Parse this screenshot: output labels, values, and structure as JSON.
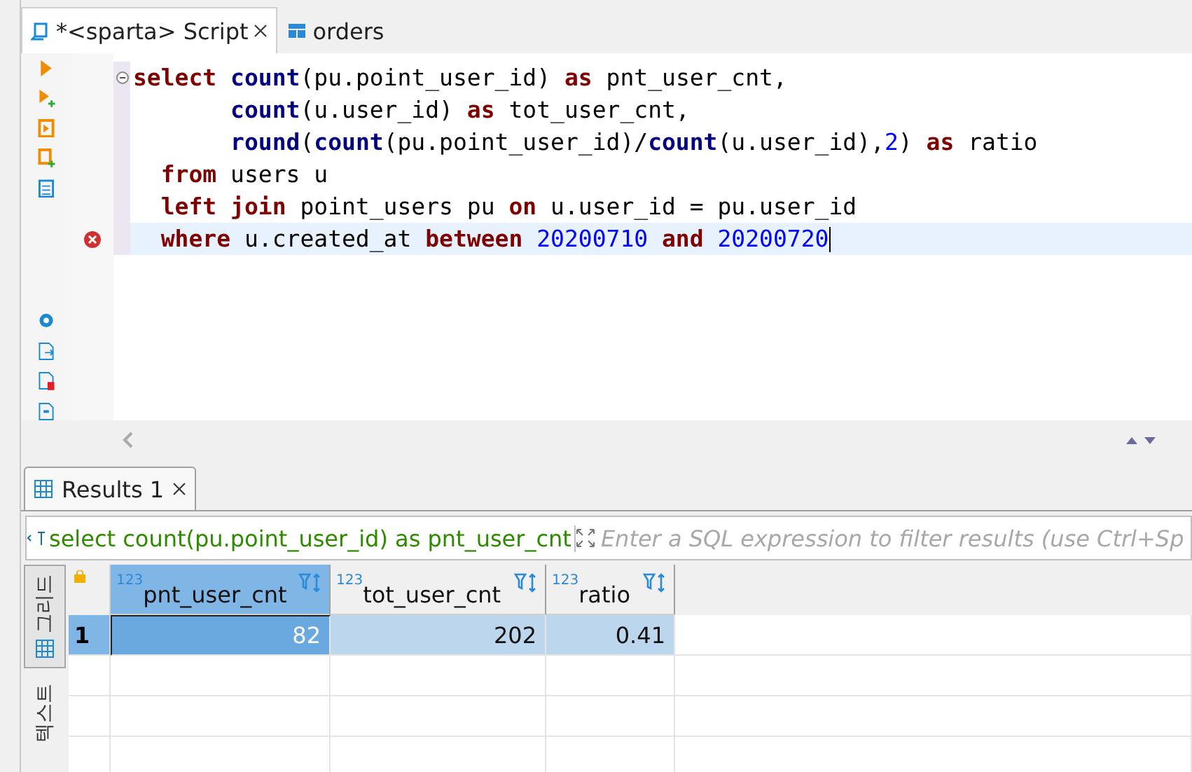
{
  "editor_tabs": [
    {
      "label": "*<sparta> Script",
      "kind": "script",
      "selected": true
    },
    {
      "label": "orders",
      "kind": "table",
      "selected": false
    }
  ],
  "sql_lines": [
    {
      "kind": "head",
      "error": false,
      "current": false,
      "fold": true,
      "tokens": [
        {
          "kind": "keyword",
          "text": "select "
        },
        {
          "kind": "function",
          "text": "count"
        },
        {
          "kind": "plain",
          "text": "(pu.point_user_id) "
        },
        {
          "kind": "keyword",
          "text": "as"
        },
        {
          "kind": "plain",
          "text": " pnt_user_cnt,"
        }
      ]
    },
    {
      "kind": "item",
      "error": false,
      "current": false,
      "fold": false,
      "tokens": [
        {
          "kind": "function",
          "text": "count"
        },
        {
          "kind": "plain",
          "text": "(u.user_id) "
        },
        {
          "kind": "keyword",
          "text": "as"
        },
        {
          "kind": "plain",
          "text": " tot_user_cnt,"
        }
      ]
    },
    {
      "kind": "item",
      "error": false,
      "current": false,
      "fold": false,
      "tokens": [
        {
          "kind": "function",
          "text": "round"
        },
        {
          "kind": "plain",
          "text": "("
        },
        {
          "kind": "function",
          "text": "count"
        },
        {
          "kind": "plain",
          "text": "(pu.point_user_id)/"
        },
        {
          "kind": "function",
          "text": "count"
        },
        {
          "kind": "plain",
          "text": "(u.user_id),"
        },
        {
          "kind": "number",
          "text": "2"
        },
        {
          "kind": "plain",
          "text": ") "
        },
        {
          "kind": "keyword",
          "text": "as"
        },
        {
          "kind": "plain",
          "text": " ratio"
        }
      ]
    },
    {
      "kind": "clause",
      "error": false,
      "current": false,
      "fold": false,
      "tokens": [
        {
          "kind": "keyword",
          "text": "from"
        },
        {
          "kind": "plain",
          "text": " users u"
        }
      ]
    },
    {
      "kind": "clause",
      "error": false,
      "current": false,
      "fold": false,
      "tokens": [
        {
          "kind": "keyword",
          "text": "left join"
        },
        {
          "kind": "plain",
          "text": " point_users pu "
        },
        {
          "kind": "keyword",
          "text": "on"
        },
        {
          "kind": "plain",
          "text": " u.user_id = pu.user_id"
        }
      ]
    },
    {
      "kind": "clause",
      "error": true,
      "current": true,
      "fold": false,
      "tokens": [
        {
          "kind": "keyword",
          "text": "where"
        },
        {
          "kind": "plain",
          "text": " u.created_at "
        },
        {
          "kind": "keyword",
          "text": "between"
        },
        {
          "kind": "number",
          "text": " 20200710 "
        },
        {
          "kind": "keyword",
          "text": "and"
        },
        {
          "kind": "number",
          "text": " 20200720"
        }
      ]
    }
  ],
  "results_tab": {
    "label": "Results 1",
    "selected": true
  },
  "filter": {
    "query": "select count(pu.point_user_id) as pnt_user_cnt",
    "placeholder": "Enter a SQL expression to filter results (use Ctrl+Sp"
  },
  "side_tabs": [
    {
      "label": "그리드",
      "selected": true
    },
    {
      "label": "텍스트",
      "selected": false
    }
  ],
  "table": {
    "columns": [
      {
        "type": "123",
        "name": "pnt_user_cnt",
        "selected": true
      },
      {
        "type": "123",
        "name": "tot_user_cnt",
        "selected": false
      },
      {
        "type": "123",
        "name": "ratio",
        "selected": false
      }
    ],
    "rows": [
      {
        "number": "1",
        "selected": true,
        "cells": [
          {
            "value": "82",
            "focused": true
          },
          {
            "value": "202",
            "focused": false
          },
          {
            "value": "0.41",
            "focused": false
          }
        ]
      }
    ]
  }
}
